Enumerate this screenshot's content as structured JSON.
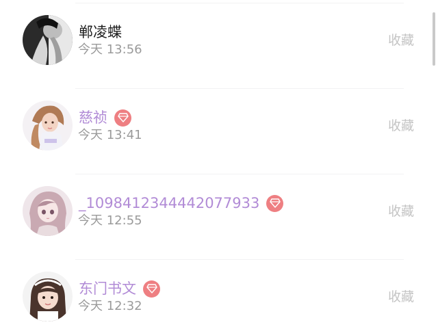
{
  "users": [
    {
      "name": "郸凌蝶",
      "time": "今天 13:56",
      "action": "收藏",
      "vip": false,
      "avatar": "avatar-bw-man"
    },
    {
      "name": "慈祯",
      "time": "今天 13:41",
      "action": "收藏",
      "vip": true,
      "avatar": "avatar-girl-pink"
    },
    {
      "name": "_1098412344442077933",
      "time": "今天 12:55",
      "action": "收藏",
      "vip": true,
      "avatar": "avatar-anime-girl"
    },
    {
      "name": "东门书文",
      "time": "今天 12:32",
      "action": "收藏",
      "vip": true,
      "avatar": "avatar-girl-headband"
    }
  ],
  "icons": {
    "vip_badge": "diamond-icon"
  },
  "colors": {
    "vip_name": "#b18bd6",
    "plain_name": "#1d1d1d",
    "time": "#9a9a9a",
    "action": "#c4c4c4",
    "vip_badge": "#ee7f82"
  }
}
